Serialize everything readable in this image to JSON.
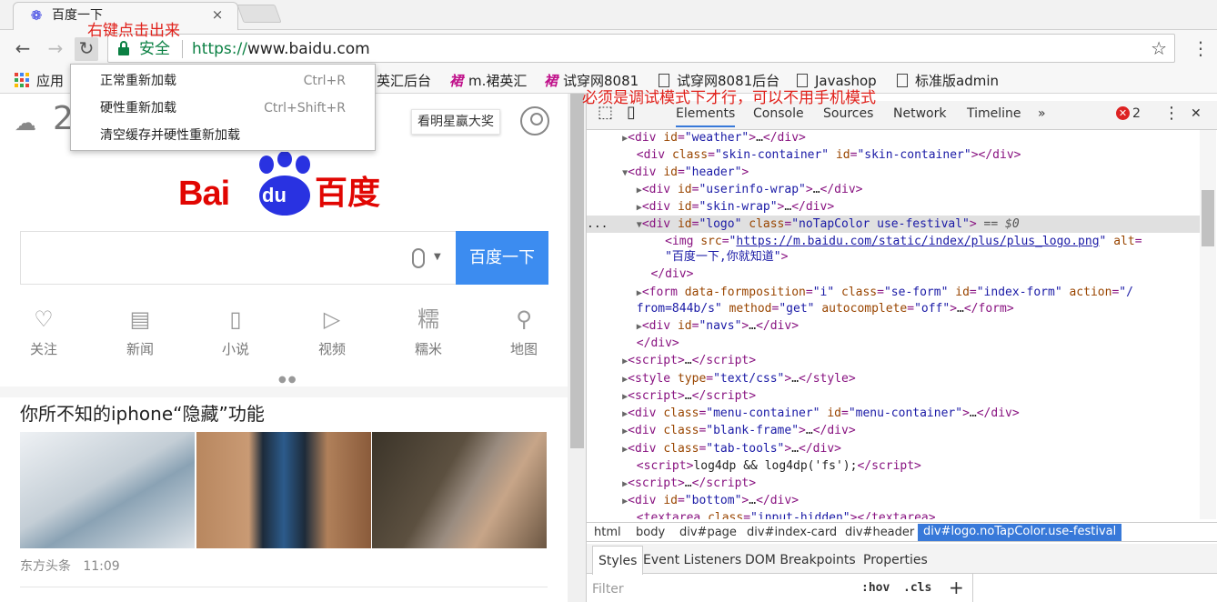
{
  "browser": {
    "tab_title": "百度一下",
    "tab_close": "×",
    "secure_label": "安全",
    "url_scheme": "https://",
    "url_host": "www.baidu.com",
    "annotation_reload": "右键点击出来",
    "reload_glyph": "↻",
    "back_glyph": "←",
    "forward_glyph": "→",
    "star_glyph": "☆",
    "menu_glyph": "⋮"
  },
  "bookmarks": {
    "apps": "应用",
    "items": [
      {
        "label": "英汇后台"
      },
      {
        "label": "m.裙英汇",
        "icon": "裙"
      },
      {
        "label": "试穿网8081",
        "icon": "裙"
      },
      {
        "label": "试穿网8081后台"
      },
      {
        "label": "Javashop"
      },
      {
        "label": "标准版admin"
      }
    ]
  },
  "context_menu": [
    {
      "label": "正常重新加载",
      "shortcut": "Ctrl+R"
    },
    {
      "label": "硬性重新加载",
      "shortcut": "Ctrl+Shift+R"
    },
    {
      "label": "清空缓存并硬性重新加载",
      "shortcut": ""
    }
  ],
  "page": {
    "weather_temp": "2",
    "star_button": "看明星赢大奖",
    "logo_bai": "Bai",
    "logo_du": "du",
    "logo_cn": "百度",
    "search_button": "百度一下",
    "nav": [
      {
        "label": "关注",
        "icon": "♡"
      },
      {
        "label": "新闻",
        "icon": "▤"
      },
      {
        "label": "小说",
        "icon": "▯"
      },
      {
        "label": "视频",
        "icon": "▷"
      },
      {
        "label": "糯米",
        "icon": "糯"
      },
      {
        "label": "地图",
        "icon": "⚲"
      }
    ],
    "dots": "●●",
    "news_title": "你所不知的iphone“隐藏”功能",
    "news_source": "东方头条",
    "news_time": "11:09"
  },
  "devtools": {
    "annotation": "必须是调试模式下才行，可以不用手机模式",
    "tabs": [
      "Elements",
      "Console",
      "Sources",
      "Network",
      "Timeline"
    ],
    "more_tabs": "»",
    "error_count": "2",
    "breadcrumbs": [
      "html",
      "body",
      "div#page",
      "div#index-card",
      "div#header",
      "div#logo.noTapColor.use-festival"
    ],
    "style_tabs": [
      "Styles",
      "Event Listeners",
      "DOM Breakpoints",
      "Properties"
    ],
    "filter_placeholder": "Filter",
    "hov": ":hov",
    "cls": ".cls",
    "plus": "+"
  },
  "colors": {
    "accent": "#3879d9",
    "baidu_red": "#e10602",
    "baidu_blue": "#2932e1",
    "search_button": "#3c8cf0",
    "annotation": "#e0211b",
    "secure_green": "#0b8043"
  }
}
